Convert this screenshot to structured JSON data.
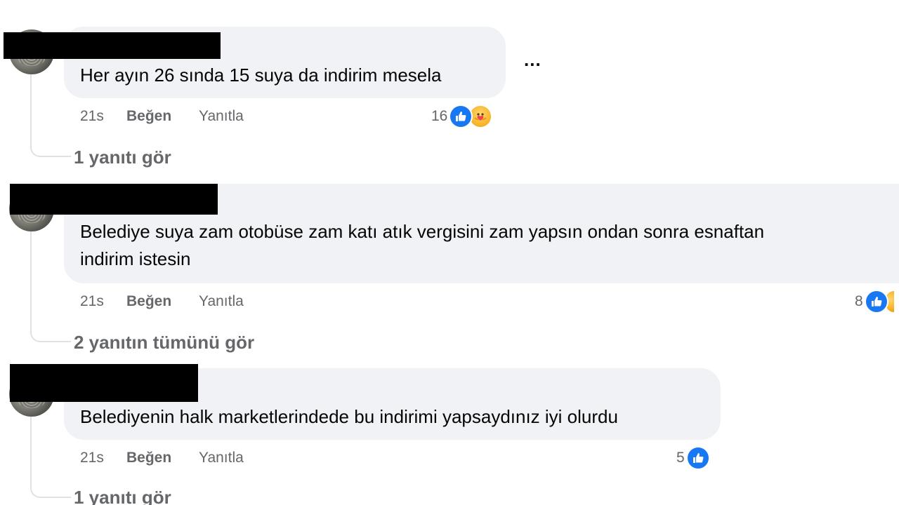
{
  "comments": [
    {
      "text": "Her ayın 26 sında 15 suya da indirim mesela",
      "time": "21s",
      "like_label": "Beğen",
      "reply_label": "Yanıtla",
      "reaction_count": "16",
      "reactions": [
        "like-icon",
        "care-icon"
      ],
      "more_label": "...",
      "view_replies": "1 yanıtı gör"
    },
    {
      "text_line1": "Belediye suya zam otobüse zam katı atık vergisini zam yapsın ondan sonra esnaftan",
      "text_line2": "indirim istesin",
      "time": "21s",
      "like_label": "Beğen",
      "reply_label": "Yanıtla",
      "reaction_count": "8",
      "reactions": [
        "like-icon",
        "care-icon"
      ],
      "view_replies": "2 yanıtın tümünü gör"
    },
    {
      "text": "Belediyenin halk marketlerindede bu indirimi yapsaydınız iyi olurdu",
      "time": "21s",
      "like_label": "Beğen",
      "reply_label": "Yanıtla",
      "reaction_count": "5",
      "reactions": [
        "like-icon"
      ],
      "view_replies": "1 yanıtı gör"
    }
  ],
  "colors": {
    "bubble": "#f0f2f5",
    "meta_text": "#65676b",
    "like_blue": "#1877f2"
  }
}
